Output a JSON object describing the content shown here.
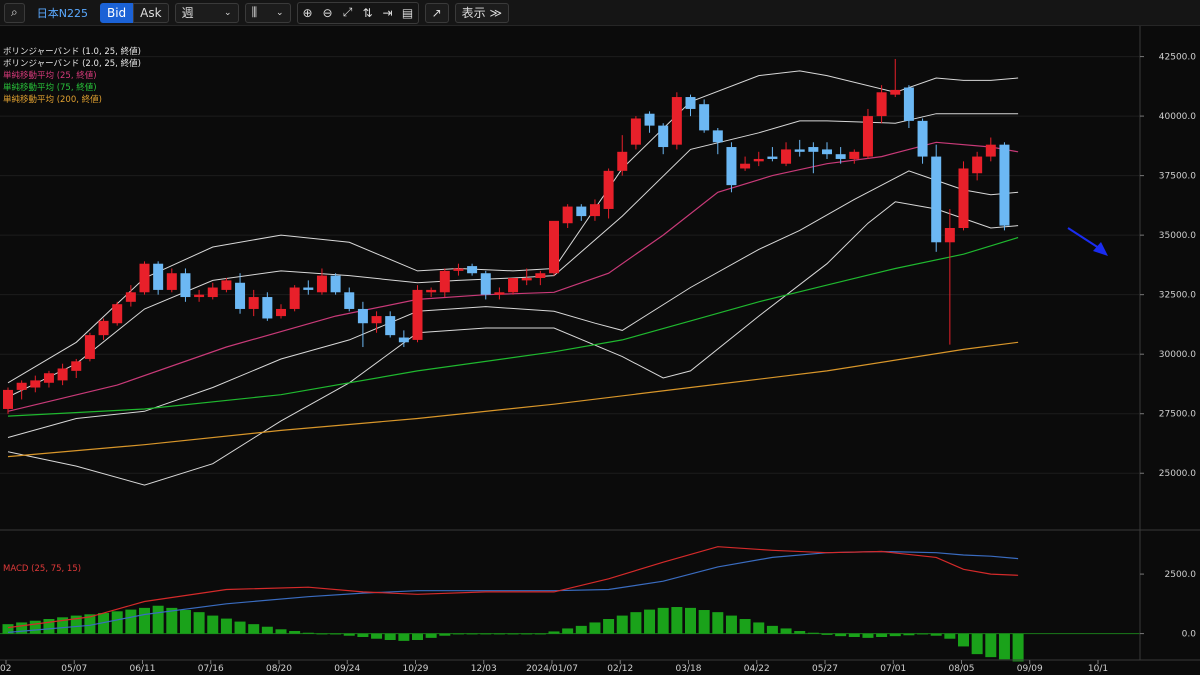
{
  "toolbar": {
    "symbol": "日本N225",
    "bid_label": "Bid",
    "ask_label": "Ask",
    "period_value": "週",
    "display_label": "表示 ≫"
  },
  "legend": [
    {
      "label": "ボリンジャーバンド (1.0, 25, 終値)",
      "color": "#e6e6e6"
    },
    {
      "label": "ボリンジャーバンド (2.0, 25, 終値)",
      "color": "#e6e6e6"
    },
    {
      "label": "単純移動平均 (25, 終値)",
      "color": "#d63a7a"
    },
    {
      "label": "単純移動平均 (75, 終値)",
      "color": "#28c23a"
    },
    {
      "label": "単純移動平均 (200, 終値)",
      "color": "#e0a030"
    }
  ],
  "macd_label": "MACD (25, 75, 15)",
  "colors": {
    "up": "#e8202a",
    "down": "#6cb8f4",
    "bb": "#d8d8d8",
    "ma25": "#c83a78",
    "ma75": "#1fb82f",
    "ma200": "#d8962a",
    "macd": "#d42a2a",
    "signal": "#3a6cc0",
    "hist": "#1aa21a",
    "arrow": "#1a2cf0"
  },
  "chart_data": {
    "type": "candlestick",
    "price_axis": {
      "ylim": [
        22700,
        43700
      ],
      "ticks": [
        25000,
        27500,
        30000,
        32500,
        35000,
        37500,
        40000,
        42500
      ],
      "tick_labels": [
        "25000.0",
        "27500.0",
        "30000.0",
        "32500.0",
        "35000.0",
        "37500.0",
        "40000.0",
        "42500.0"
      ]
    },
    "macd_axis": {
      "ylim": [
        -900,
        4100
      ],
      "ticks": [
        0,
        2500
      ],
      "tick_labels": [
        "0.0",
        "2500.0"
      ]
    },
    "x_labels": [
      {
        "i": 0,
        "label": "02"
      },
      {
        "i": 5,
        "label": "05/07"
      },
      {
        "i": 10,
        "label": "06/11"
      },
      {
        "i": 15,
        "label": "07/16"
      },
      {
        "i": 20,
        "label": "08/20"
      },
      {
        "i": 25,
        "label": "09/24"
      },
      {
        "i": 30,
        "label": "10/29"
      },
      {
        "i": 35,
        "label": "12/03"
      },
      {
        "i": 40,
        "label": "2024/01/07"
      },
      {
        "i": 45,
        "label": "02/12"
      },
      {
        "i": 50,
        "label": "03/18"
      },
      {
        "i": 55,
        "label": "04/22"
      },
      {
        "i": 60,
        "label": "05/27"
      },
      {
        "i": 65,
        "label": "07/01"
      },
      {
        "i": 70,
        "label": "08/05"
      },
      {
        "i": 75,
        "label": "09/09"
      },
      {
        "i": 80,
        "label": "10/1"
      }
    ],
    "candles": [
      {
        "o": 27700,
        "h": 28600,
        "l": 27500,
        "c": 28500
      },
      {
        "o": 28500,
        "h": 28900,
        "l": 28100,
        "c": 28800
      },
      {
        "o": 28600,
        "h": 29100,
        "l": 28400,
        "c": 28900
      },
      {
        "o": 28800,
        "h": 29300,
        "l": 28600,
        "c": 29200
      },
      {
        "o": 28900,
        "h": 29600,
        "l": 28700,
        "c": 29400
      },
      {
        "o": 29300,
        "h": 29800,
        "l": 29000,
        "c": 29700
      },
      {
        "o": 29800,
        "h": 30900,
        "l": 29700,
        "c": 30800
      },
      {
        "o": 30800,
        "h": 31500,
        "l": 30600,
        "c": 31400
      },
      {
        "o": 31300,
        "h": 32200,
        "l": 31200,
        "c": 32100
      },
      {
        "o": 32200,
        "h": 32900,
        "l": 32000,
        "c": 32600
      },
      {
        "o": 32600,
        "h": 33900,
        "l": 32500,
        "c": 33800
      },
      {
        "o": 33800,
        "h": 33900,
        "l": 32500,
        "c": 32700
      },
      {
        "o": 32700,
        "h": 33600,
        "l": 32600,
        "c": 33400
      },
      {
        "o": 33400,
        "h": 33600,
        "l": 32200,
        "c": 32400
      },
      {
        "o": 32400,
        "h": 32700,
        "l": 32200,
        "c": 32500
      },
      {
        "o": 32400,
        "h": 33000,
        "l": 32300,
        "c": 32800
      },
      {
        "o": 32700,
        "h": 33200,
        "l": 32600,
        "c": 33100
      },
      {
        "o": 33000,
        "h": 33400,
        "l": 31700,
        "c": 31900
      },
      {
        "o": 31900,
        "h": 32700,
        "l": 31600,
        "c": 32400
      },
      {
        "o": 32400,
        "h": 32600,
        "l": 31400,
        "c": 31500
      },
      {
        "o": 31600,
        "h": 32100,
        "l": 31500,
        "c": 31900
      },
      {
        "o": 31900,
        "h": 32900,
        "l": 31800,
        "c": 32800
      },
      {
        "o": 32800,
        "h": 33100,
        "l": 32500,
        "c": 32700
      },
      {
        "o": 32600,
        "h": 33600,
        "l": 32500,
        "c": 33300
      },
      {
        "o": 33300,
        "h": 33400,
        "l": 32500,
        "c": 32600
      },
      {
        "o": 32600,
        "h": 32800,
        "l": 31800,
        "c": 31900
      },
      {
        "o": 31900,
        "h": 32200,
        "l": 30300,
        "c": 31300
      },
      {
        "o": 31300,
        "h": 31800,
        "l": 30900,
        "c": 31600
      },
      {
        "o": 31600,
        "h": 31800,
        "l": 30700,
        "c": 30800
      },
      {
        "o": 30700,
        "h": 31000,
        "l": 30300,
        "c": 30500
      },
      {
        "o": 30600,
        "h": 32900,
        "l": 30500,
        "c": 32700
      },
      {
        "o": 32600,
        "h": 32800,
        "l": 32400,
        "c": 32700
      },
      {
        "o": 32600,
        "h": 33600,
        "l": 32400,
        "c": 33500
      },
      {
        "o": 33500,
        "h": 33800,
        "l": 33300,
        "c": 33600
      },
      {
        "o": 33700,
        "h": 33800,
        "l": 33300,
        "c": 33400
      },
      {
        "o": 33400,
        "h": 33500,
        "l": 32300,
        "c": 32500
      },
      {
        "o": 32500,
        "h": 32800,
        "l": 32300,
        "c": 32600
      },
      {
        "o": 32600,
        "h": 33200,
        "l": 32500,
        "c": 33200
      },
      {
        "o": 33100,
        "h": 33600,
        "l": 32900,
        "c": 33200
      },
      {
        "o": 33200,
        "h": 33500,
        "l": 32900,
        "c": 33400
      },
      {
        "o": 33400,
        "h": 35000,
        "l": 33300,
        "c": 35600
      },
      {
        "o": 35500,
        "h": 36300,
        "l": 35300,
        "c": 36200
      },
      {
        "o": 36200,
        "h": 36300,
        "l": 35600,
        "c": 35800
      },
      {
        "o": 35800,
        "h": 36500,
        "l": 35600,
        "c": 36300
      },
      {
        "o": 36100,
        "h": 37800,
        "l": 35700,
        "c": 37700
      },
      {
        "o": 37700,
        "h": 39200,
        "l": 37500,
        "c": 38500
      },
      {
        "o": 38800,
        "h": 40000,
        "l": 38600,
        "c": 39900
      },
      {
        "o": 40100,
        "h": 40200,
        "l": 39300,
        "c": 39600
      },
      {
        "o": 39600,
        "h": 39700,
        "l": 38400,
        "c": 38700
      },
      {
        "o": 38800,
        "h": 41000,
        "l": 38600,
        "c": 40800
      },
      {
        "o": 40800,
        "h": 40900,
        "l": 40000,
        "c": 40300
      },
      {
        "o": 40500,
        "h": 40700,
        "l": 39300,
        "c": 39400
      },
      {
        "o": 39400,
        "h": 39500,
        "l": 38400,
        "c": 38900
      },
      {
        "o": 38700,
        "h": 38900,
        "l": 36800,
        "c": 37100
      },
      {
        "o": 37800,
        "h": 38300,
        "l": 37700,
        "c": 38000
      },
      {
        "o": 38100,
        "h": 38500,
        "l": 37900,
        "c": 38200
      },
      {
        "o": 38300,
        "h": 38700,
        "l": 38100,
        "c": 38200
      },
      {
        "o": 38000,
        "h": 38900,
        "l": 37900,
        "c": 38600
      },
      {
        "o": 38600,
        "h": 39000,
        "l": 38300,
        "c": 38500
      },
      {
        "o": 38700,
        "h": 38900,
        "l": 37600,
        "c": 38500
      },
      {
        "o": 38600,
        "h": 38900,
        "l": 38200,
        "c": 38400
      },
      {
        "o": 38400,
        "h": 38700,
        "l": 38000,
        "c": 38200
      },
      {
        "o": 38200,
        "h": 38600,
        "l": 38000,
        "c": 38500
      },
      {
        "o": 38300,
        "h": 40300,
        "l": 38200,
        "c": 40000
      },
      {
        "o": 40000,
        "h": 41300,
        "l": 39700,
        "c": 41000
      },
      {
        "o": 40900,
        "h": 42400,
        "l": 40800,
        "c": 41100
      },
      {
        "o": 41200,
        "h": 41300,
        "l": 39500,
        "c": 39800
      },
      {
        "o": 39800,
        "h": 39900,
        "l": 38000,
        "c": 38300
      },
      {
        "o": 38300,
        "h": 38800,
        "l": 34300,
        "c": 34700
      },
      {
        "o": 34700,
        "h": 36100,
        "l": 30400,
        "c": 35300
      },
      {
        "o": 35300,
        "h": 38100,
        "l": 35200,
        "c": 37800
      },
      {
        "o": 37600,
        "h": 38500,
        "l": 37300,
        "c": 38300
      },
      {
        "o": 38300,
        "h": 39100,
        "l": 38100,
        "c": 38800
      },
      {
        "o": 38800,
        "h": 38900,
        "l": 35200,
        "c": 35400
      }
    ],
    "ma25": {
      "x": [
        0,
        8,
        16,
        24,
        30,
        35,
        40,
        44,
        48,
        52,
        56,
        60,
        64,
        68,
        72,
        74
      ],
      "y": [
        27600,
        28700,
        30300,
        31600,
        32300,
        32500,
        32600,
        33400,
        35000,
        36800,
        37500,
        38000,
        38300,
        38900,
        38700,
        38500
      ]
    },
    "ma75": {
      "x": [
        0,
        10,
        20,
        30,
        40,
        45,
        50,
        55,
        60,
        65,
        70,
        74
      ],
      "y": [
        27400,
        27700,
        28300,
        29300,
        30100,
        30600,
        31400,
        32200,
        32900,
        33600,
        34200,
        34900
      ]
    },
    "ma200": {
      "x": [
        0,
        10,
        20,
        30,
        40,
        50,
        60,
        70,
        74
      ],
      "y": [
        25700,
        26200,
        26800,
        27300,
        27900,
        28600,
        29300,
        30200,
        30500
      ]
    },
    "bb2_upper": {
      "x": [
        0,
        5,
        10,
        15,
        20,
        25,
        30,
        33,
        37,
        40,
        45,
        50,
        55,
        58,
        60,
        65,
        68,
        70,
        72,
        74
      ],
      "y": [
        28800,
        30500,
        33200,
        34500,
        35000,
        34700,
        33500,
        33600,
        33500,
        33600,
        37800,
        40600,
        41700,
        41900,
        41700,
        41000,
        41600,
        41500,
        41500,
        41600
      ]
    },
    "bb1_upper": {
      "x": [
        0,
        5,
        10,
        15,
        20,
        25,
        30,
        33,
        37,
        40,
        45,
        50,
        55,
        58,
        60,
        65,
        68,
        70,
        72,
        74
      ],
      "y": [
        28200,
        29600,
        31900,
        33100,
        33500,
        33300,
        33000,
        33100,
        33200,
        33300,
        35800,
        38600,
        39300,
        39800,
        39800,
        39700,
        40100,
        40100,
        40100,
        40100
      ]
    },
    "bb1_lower": {
      "x": [
        0,
        5,
        10,
        15,
        20,
        25,
        30,
        35,
        40,
        43,
        45,
        50,
        55,
        58,
        62,
        66,
        68,
        70,
        72,
        74
      ],
      "y": [
        26500,
        27300,
        27600,
        28600,
        29800,
        30600,
        31800,
        32000,
        31800,
        31300,
        31000,
        32800,
        34400,
        35200,
        36500,
        37700,
        37300,
        36900,
        36700,
        36800
      ]
    },
    "bb2_lower": {
      "x": [
        0,
        5,
        10,
        15,
        20,
        25,
        30,
        35,
        40,
        45,
        48,
        50,
        55,
        60,
        63,
        65,
        68,
        70,
        72,
        74
      ],
      "y": [
        25900,
        25300,
        24500,
        25400,
        27200,
        28800,
        30900,
        31100,
        31100,
        29900,
        29000,
        29300,
        31600,
        33800,
        35500,
        36400,
        36100,
        35700,
        35300,
        35400
      ]
    },
    "macd": {
      "x": [
        0,
        6,
        10,
        16,
        22,
        26,
        30,
        35,
        40,
        44,
        48,
        52,
        56,
        60,
        64,
        68,
        70,
        72,
        74
      ],
      "y": [
        250,
        700,
        1350,
        1850,
        1950,
        1750,
        1650,
        1750,
        1750,
        2300,
        3000,
        3650,
        3500,
        3400,
        3450,
        3200,
        2700,
        2500,
        2450
      ]
    },
    "signal": {
      "x": [
        0,
        6,
        10,
        16,
        22,
        26,
        30,
        35,
        40,
        44,
        48,
        52,
        56,
        60,
        64,
        68,
        70,
        72,
        74
      ],
      "y": [
        50,
        350,
        800,
        1250,
        1550,
        1700,
        1800,
        1800,
        1800,
        1850,
        2200,
        2800,
        3200,
        3400,
        3450,
        3400,
        3300,
        3250,
        3150
      ]
    },
    "hist": [
      0.22,
      0.26,
      0.3,
      0.34,
      0.38,
      0.42,
      0.45,
      0.48,
      0.52,
      0.56,
      0.6,
      0.65,
      0.6,
      0.55,
      0.5,
      0.42,
      0.35,
      0.28,
      0.22,
      0.16,
      0.1,
      0.06,
      0.02,
      0,
      -0.02,
      -0.05,
      -0.08,
      -0.12,
      -0.15,
      -0.17,
      -0.15,
      -0.1,
      -0.05,
      0,
      0,
      0,
      0,
      0,
      0,
      0,
      0.05,
      0.12,
      0.18,
      0.26,
      0.34,
      0.42,
      0.5,
      0.56,
      0.6,
      0.62,
      0.6,
      0.55,
      0.5,
      0.42,
      0.34,
      0.26,
      0.18,
      0.12,
      0.06,
      0.02,
      -0.03,
      -0.06,
      -0.08,
      -0.1,
      -0.08,
      -0.06,
      -0.04,
      -0.02,
      -0.05,
      -0.12,
      -0.3,
      -0.48,
      -0.55,
      -0.6,
      -0.65
    ]
  }
}
